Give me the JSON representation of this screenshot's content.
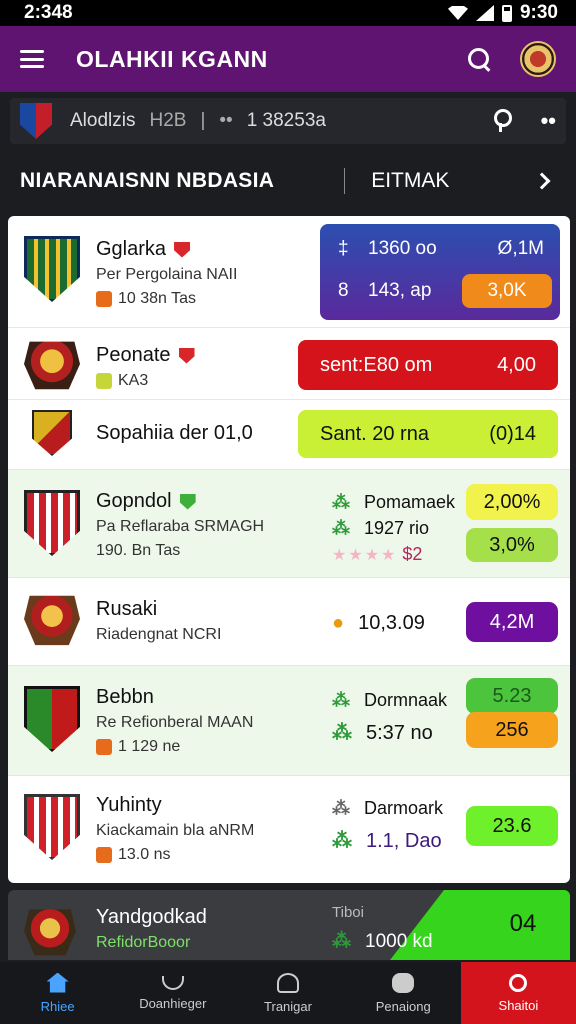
{
  "status": {
    "time": "2:348",
    "clock": "9:30"
  },
  "appbar": {
    "title": "OLAHKII KGANN"
  },
  "match": {
    "text": "Alodlzis",
    "code": "H2B",
    "sep": "|",
    "dots": "••",
    "number": "1 38253a",
    "more": "••"
  },
  "section": {
    "title": "NIARANAISNN NBDASIA",
    "filter": "EITMAK"
  },
  "rows": [
    {
      "name": "Gglarka",
      "sub": "Per Pergolaina NAII",
      "meta": "10 38n Tas",
      "card": {
        "l1": "‡",
        "v1": "1360 oo",
        "r1": "Ø,1M",
        "l2": "8",
        "v2": "143, ap",
        "btn": "3,0K"
      }
    },
    {
      "name": "Peonate",
      "meta": "KA3",
      "pill_left": "sent:E80 om",
      "pill_right": "4,00"
    },
    {
      "name": "Sopahiia der 01,0",
      "pill_left": "Sant. 20 rna",
      "pill_right": "(0)14"
    },
    {
      "name": "Gopndol",
      "sub": "Pa Reflaraba SRMAGH",
      "meta": "190. Bn Tas",
      "mid1": "Pomamaek",
      "mid2": "1927 rio",
      "stars": "★★★★",
      "mid3": "$2",
      "btn1": "2,00%",
      "btn2": "3,0%"
    },
    {
      "name": "Rusaki",
      "sub": "Riadengnat NCRI",
      "mid1": "10,3.09",
      "btn1": "4,2M"
    },
    {
      "name": "Bebbn",
      "sub": "Re Refionberal MAAN",
      "meta": "1 129 ne",
      "mid1": "Dormnaak",
      "mid2": "5:37 no",
      "btn1": "5.23",
      "btn2": "256"
    },
    {
      "name": "Yuhinty",
      "sub": "Kiackamain bla aNRM",
      "meta": "13.0 ns",
      "mid1": "Darmoark",
      "mid2": "1.1, Dao",
      "btn1": "23.6"
    }
  ],
  "last": {
    "name": "Yandgodkad",
    "sub": "RefidorBooor",
    "mid1": "Tiboi",
    "mid2": "1000 kd",
    "score": "04"
  },
  "nav": [
    {
      "label": "Rhiee",
      "icon": "home-icon"
    },
    {
      "label": "Doanhieger",
      "icon": "bowl-icon"
    },
    {
      "label": "Tranigar",
      "icon": "user-icon"
    },
    {
      "label": "Penaiong",
      "icon": "gamepad-icon"
    },
    {
      "label": "Shaitoi",
      "icon": "search-icon"
    }
  ],
  "colors": {
    "appbar": "#5e1470",
    "accent_red": "#d3141c",
    "lime": "#c9f034"
  }
}
